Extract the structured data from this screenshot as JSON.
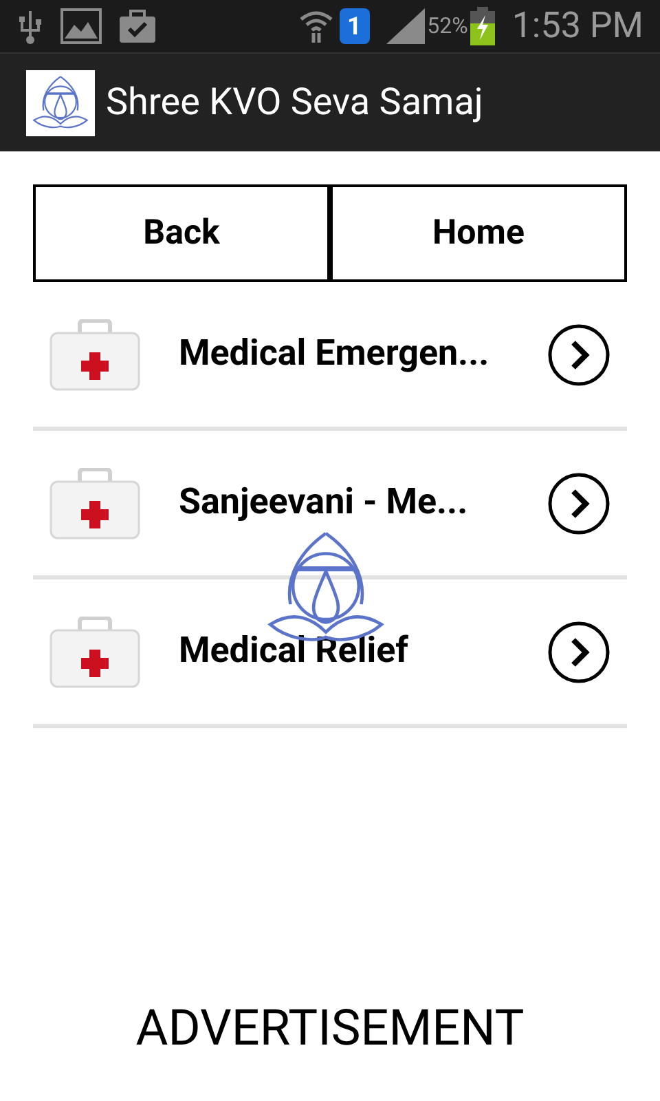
{
  "status_bar": {
    "sim_badge": "1",
    "battery_percent": "52%",
    "time": "1:53 PM"
  },
  "app_bar": {
    "title": "Shree KVO Seva Samaj"
  },
  "buttons": [
    "Back",
    "Home"
  ],
  "items": [
    {
      "label": "Medical Emergen..."
    },
    {
      "label": "Sanjeevani - Me..."
    },
    {
      "label": "Medical Relief"
    }
  ],
  "footer": "ADVERTISEMENT"
}
